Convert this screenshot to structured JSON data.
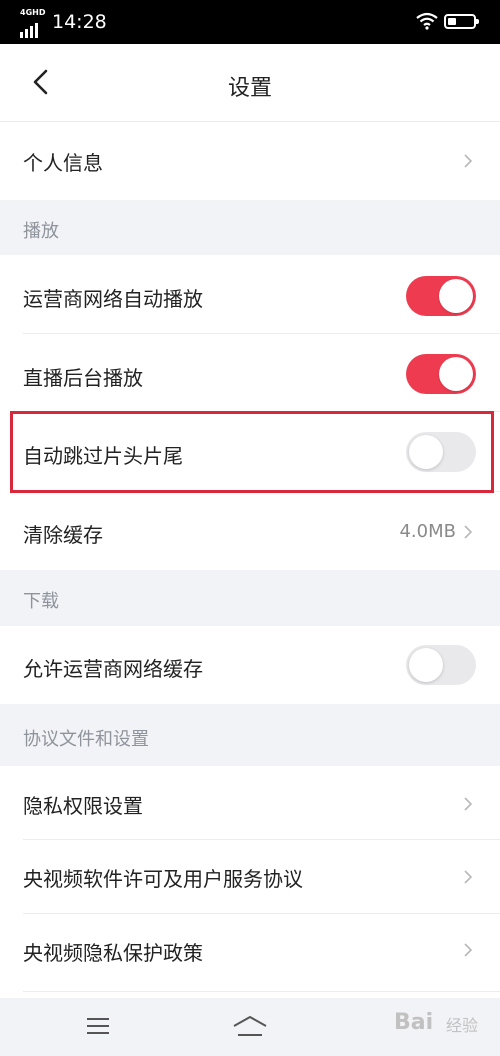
{
  "status_bar": {
    "network": "4GHD",
    "time": "14:28"
  },
  "header": {
    "title": "设置"
  },
  "rows": {
    "personal_info": "个人信息",
    "carrier_autoplay": "运营商网络自动播放",
    "live_background": "直播后台播放",
    "skip_intro": "自动跳过片头片尾",
    "clear_cache": "清除缓存",
    "cache_size": "4.0MB",
    "carrier_cache": "允许运营商网络缓存",
    "privacy_permissions": "隐私权限设置",
    "license_agreement": "央视频软件许可及用户服务协议",
    "privacy_policy": "央视频隐私保护政策"
  },
  "sections": {
    "playback": "播放",
    "download": "下载",
    "agreements": "协议文件和设置"
  },
  "toggles": {
    "carrier_autoplay": true,
    "live_background": true,
    "skip_intro": false,
    "carrier_cache": false
  },
  "colors": {
    "accent": "#ee3b4f",
    "highlight": "#d8283b",
    "background": "#f2f3f7"
  },
  "watermark": {
    "text": "Bai",
    "sub": "经验"
  }
}
